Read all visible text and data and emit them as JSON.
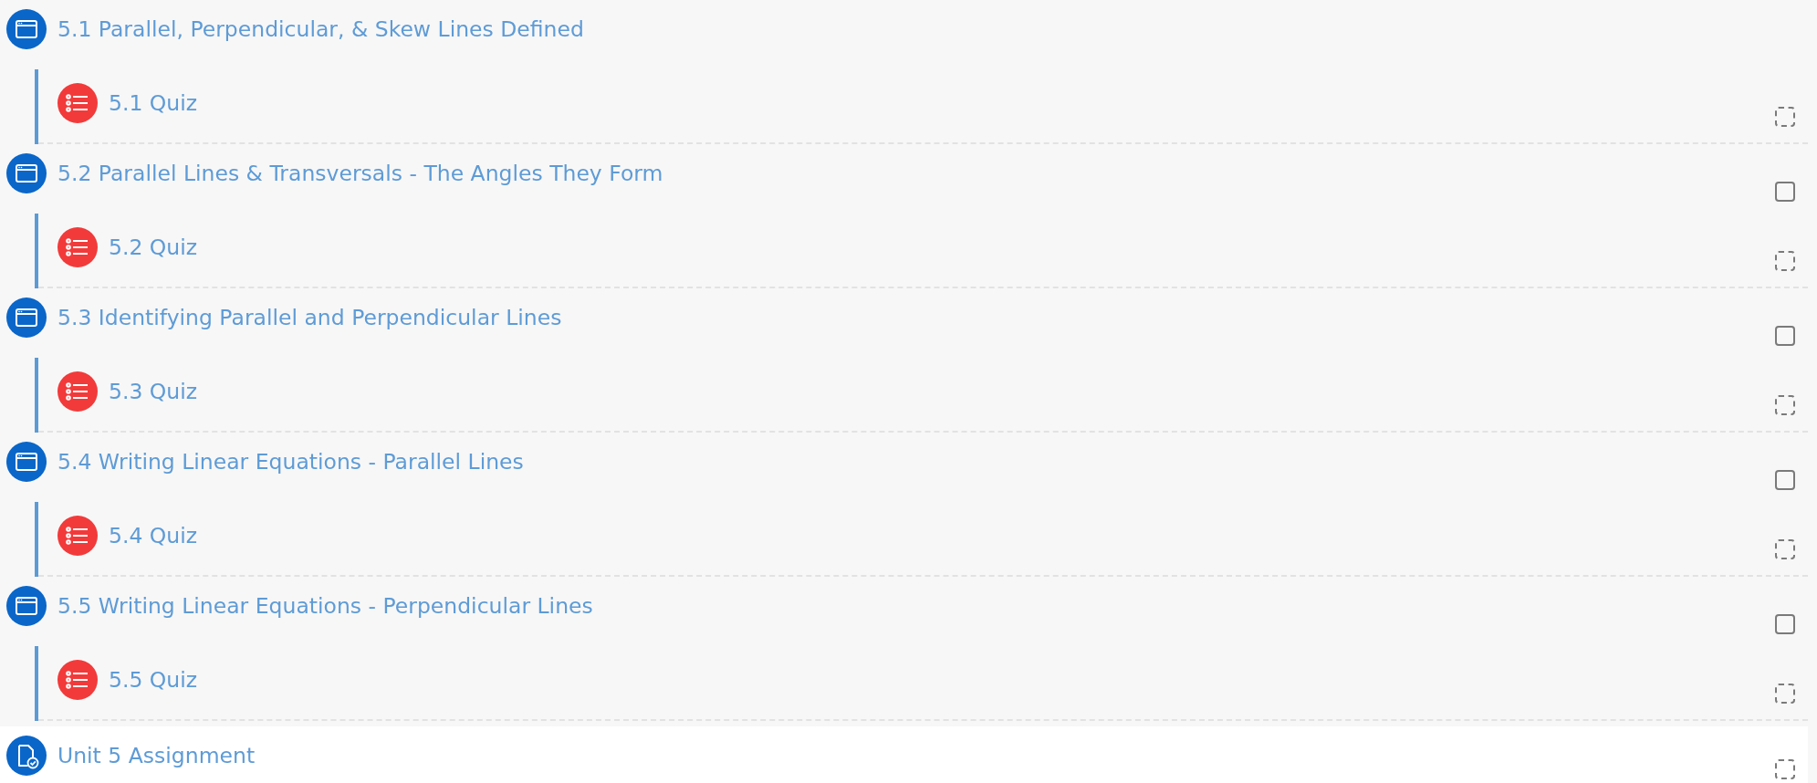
{
  "items": [
    {
      "kind": "page",
      "title": "5.1 Parallel, Perpendicular, & Skew Lines Defined",
      "children": [
        {
          "kind": "quiz",
          "title": "5.1 Quiz",
          "checkbox": {
            "kind": "auto",
            "checked": false
          }
        }
      ]
    },
    {
      "kind": "page",
      "title": "5.2 Parallel Lines & Transversals - The Angles They Form",
      "checkbox": {
        "kind": "manual",
        "checked": false
      },
      "children": [
        {
          "kind": "quiz",
          "title": "5.2 Quiz",
          "checkbox": {
            "kind": "auto",
            "checked": false
          }
        }
      ]
    },
    {
      "kind": "page",
      "title": "5.3 Identifying Parallel and Perpendicular Lines",
      "checkbox": {
        "kind": "manual",
        "checked": false
      },
      "children": [
        {
          "kind": "quiz",
          "title": "5.3 Quiz",
          "checkbox": {
            "kind": "auto",
            "checked": false
          }
        }
      ]
    },
    {
      "kind": "page",
      "title": "5.4 Writing Linear Equations - Parallel Lines",
      "checkbox": {
        "kind": "manual",
        "checked": false
      },
      "children": [
        {
          "kind": "quiz",
          "title": "5.4 Quiz",
          "checkbox": {
            "kind": "auto",
            "checked": false
          }
        }
      ]
    },
    {
      "kind": "page",
      "title": "5.5 Writing Linear Equations - Perpendicular Lines",
      "checkbox": {
        "kind": "manual",
        "checked": false
      },
      "children": [
        {
          "kind": "quiz",
          "title": "5.5 Quiz",
          "checkbox": {
            "kind": "auto",
            "checked": false
          }
        }
      ]
    },
    {
      "kind": "assignment",
      "title": "Unit 5 Assignment",
      "checkbox": {
        "kind": "auto",
        "checked": false
      }
    }
  ]
}
